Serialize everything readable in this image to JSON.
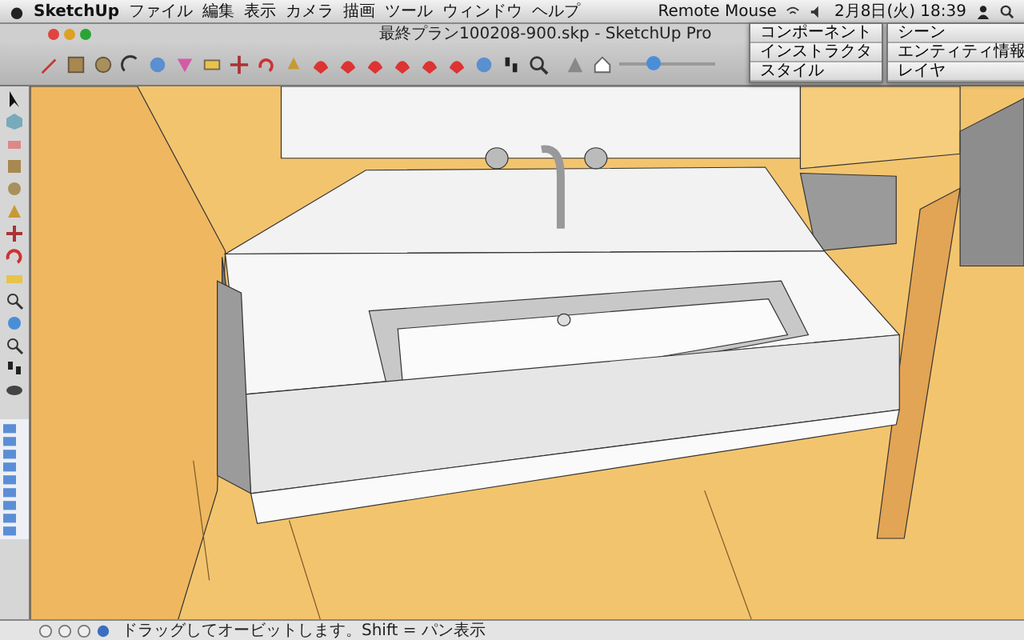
{
  "menu_bar": {
    "app": "SketchUp",
    "menus": [
      "ファイル",
      "編集",
      "表示",
      "カメラ",
      "描画",
      "ツール",
      "ウィンドウ",
      "ヘルプ"
    ],
    "status_item": "Remote Mouse",
    "clock": "2月8日(火) 18:39"
  },
  "window": {
    "title": "最終プラン100208-900.skp - SketchUp Pro"
  },
  "toolbar": {
    "shadow_slider": {
      "level": 0.35
    }
  },
  "palettes": [
    {
      "items": [
        "コンポーネント",
        "インストラクタ",
        "スタイル"
      ]
    },
    {
      "items": [
        "シーン",
        "エンティティ情報",
        "レイヤ"
      ]
    }
  ],
  "status_bar": {
    "hint": "ドラッグしてオービットします。Shift = パン表示"
  }
}
